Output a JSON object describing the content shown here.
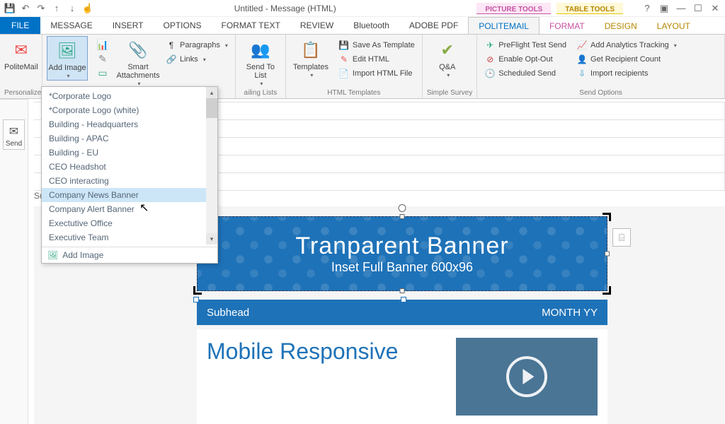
{
  "title": "Untitled - Message (HTML)",
  "context_tabs": {
    "picture": "PICTURE TOOLS",
    "table": "TABLE TOOLS"
  },
  "tabs": {
    "file": "FILE",
    "message": "MESSAGE",
    "insert": "INSERT",
    "options": "OPTIONS",
    "format_text": "FORMAT TEXT",
    "review": "REVIEW",
    "bluetooth": "Bluetooth",
    "adobe": "ADOBE PDF",
    "politemail": "POLITEMAIL",
    "format": "FORMAT",
    "design": "DESIGN",
    "layout": "LAYOUT"
  },
  "ribbon": {
    "politemail": "PoliteMail",
    "personalize": "Personalize",
    "add_image": "Add Image",
    "smart_attachments": "Smart Attachments",
    "paragraphs": "Paragraphs",
    "links": "Links",
    "send_to_list": "Send To List",
    "templates": "Templates",
    "save_template": "Save As Template",
    "edit_html": "Edit HTML",
    "import_html": "Import HTML File",
    "qa": "Q&A",
    "preflight": "PreFlight Test Send",
    "opt_out": "Enable Opt-Out",
    "scheduled": "Scheduled Send",
    "analytics": "Add Analytics Tracking",
    "recipient_count": "Get Recipient Count",
    "import_recipients": "Import recipients"
  },
  "groups": {
    "mailing": "ailing Lists",
    "html_templates": "HTML Templates",
    "survey": "Simple Survey",
    "send_options": "Send Options"
  },
  "image_menu": {
    "items": [
      "*Corporate Logo",
      "*Corporate Logo (white)",
      "Building - Headquarters",
      "Building - APAC",
      "Building - EU",
      "CEO Headshot",
      "CEO interacting",
      "Company News Banner",
      "Company Alert Banner",
      "Exectutive Office",
      "Executive Team"
    ],
    "selected_index": 7,
    "footer": "Add Image"
  },
  "send": "Send",
  "subject_label": "Su",
  "banner": {
    "title": "Tranparent Banner",
    "sub": "Inset Full Banner  600x96"
  },
  "subhead": {
    "left": "Subhead",
    "right": "MONTH YY"
  },
  "body_headline": "Mobile Responsive"
}
